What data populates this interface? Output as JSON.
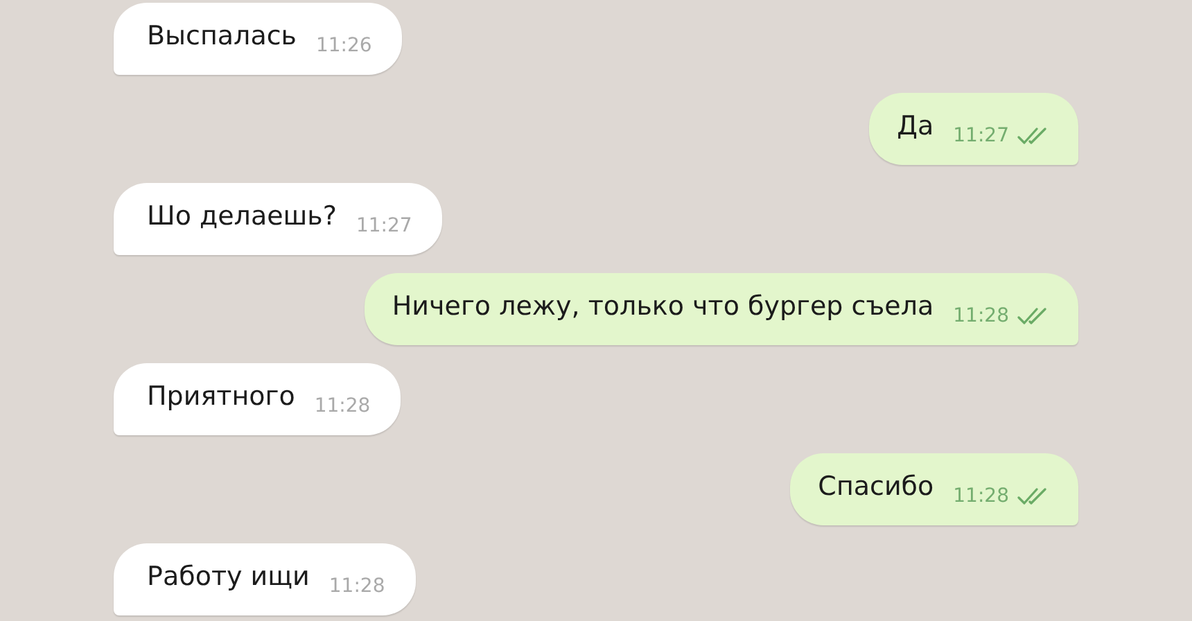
{
  "messages": [
    {
      "kind": "incoming",
      "text": "Выспалась",
      "time": "11:26"
    },
    {
      "kind": "outgoing",
      "text": "Да",
      "time": "11:27",
      "read": true
    },
    {
      "kind": "incoming",
      "text": "Шо делаешь?",
      "time": "11:27"
    },
    {
      "kind": "outgoing",
      "text": "Ничего лежу, только что бургер съела",
      "time": "11:28",
      "read": true
    },
    {
      "kind": "incoming",
      "text": "Приятного",
      "time": "11:28"
    },
    {
      "kind": "outgoing",
      "text": "Спасибо",
      "time": "11:28",
      "read": true
    },
    {
      "kind": "incoming",
      "text": "Работу ищи",
      "time": "11:28"
    }
  ]
}
